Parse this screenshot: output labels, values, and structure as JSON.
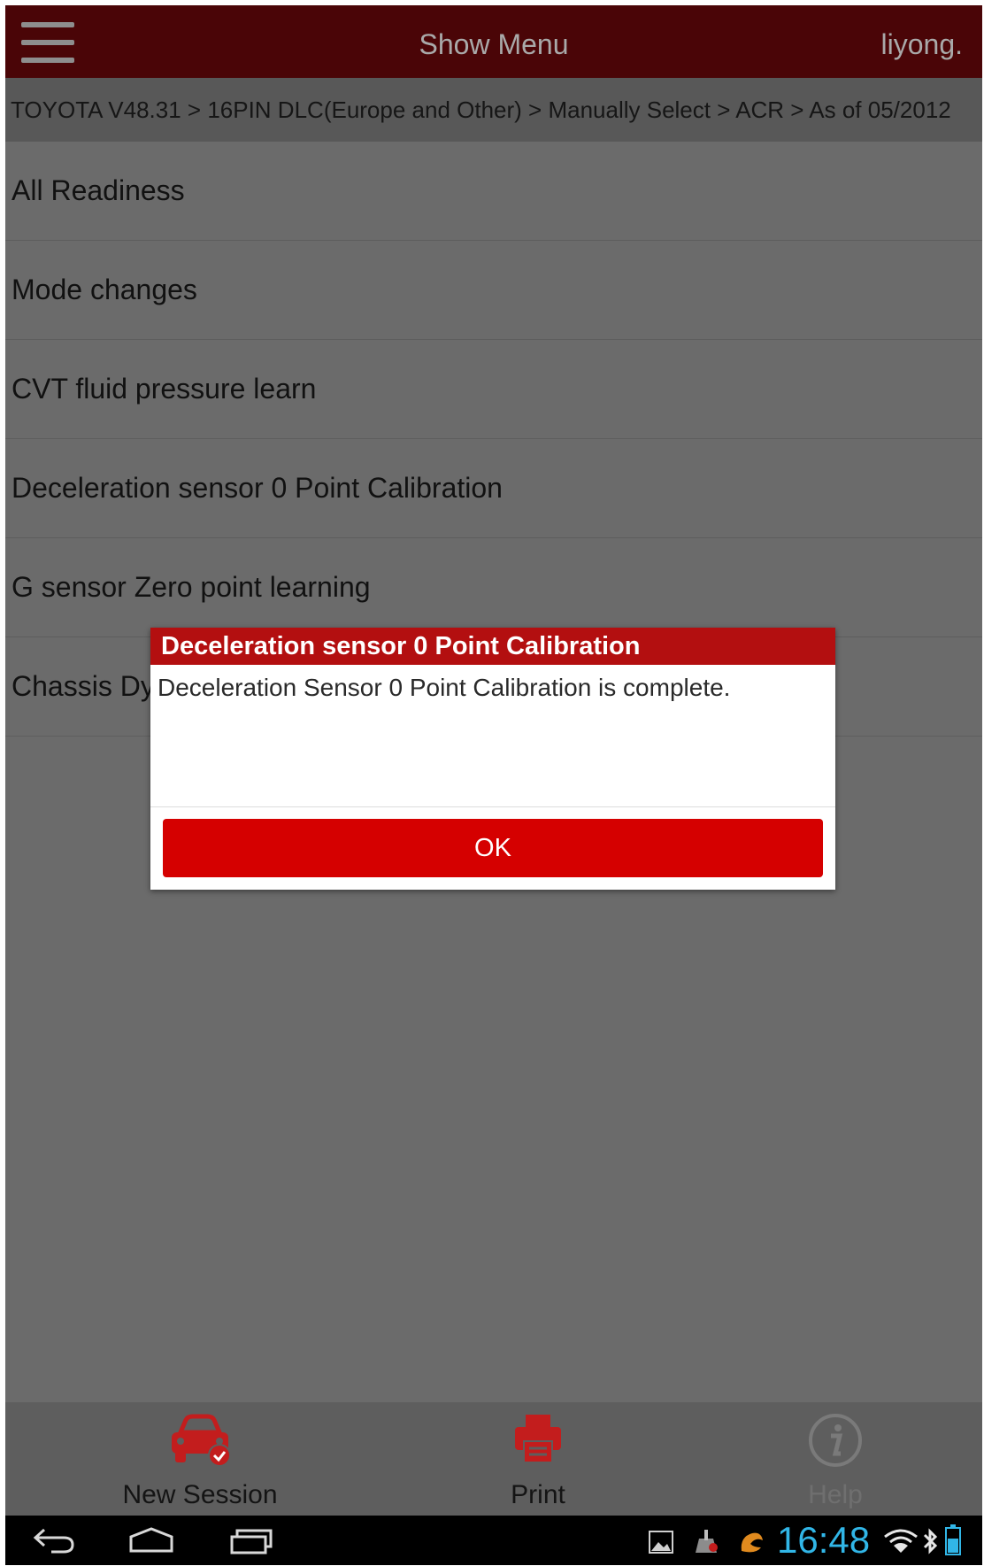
{
  "header": {
    "title": "Show Menu",
    "user": "liyong."
  },
  "breadcrumb": "TOYOTA V48.31 > 16PIN DLC(Europe and Other) > Manually Select > ACR > As of 05/2012",
  "list": {
    "items": [
      "All Readiness",
      "Mode changes",
      "CVT fluid pressure learn",
      "Deceleration sensor 0 Point Calibration",
      "G sensor Zero point learning",
      "Chassis Dy"
    ]
  },
  "dialog": {
    "title": "Deceleration sensor 0 Point Calibration",
    "message": "Deceleration Sensor 0 Point Calibration is complete.",
    "ok_label": "OK"
  },
  "toolbar": {
    "new_session_label": "New Session",
    "print_label": "Print",
    "help_label": "Help",
    "icons": {
      "new_session": "car-check-icon",
      "print": "printer-icon",
      "help": "info-icon"
    },
    "icon_color": "#c31d1d"
  },
  "status_bar": {
    "time": "16:48",
    "time_color": "#31b6e7"
  }
}
